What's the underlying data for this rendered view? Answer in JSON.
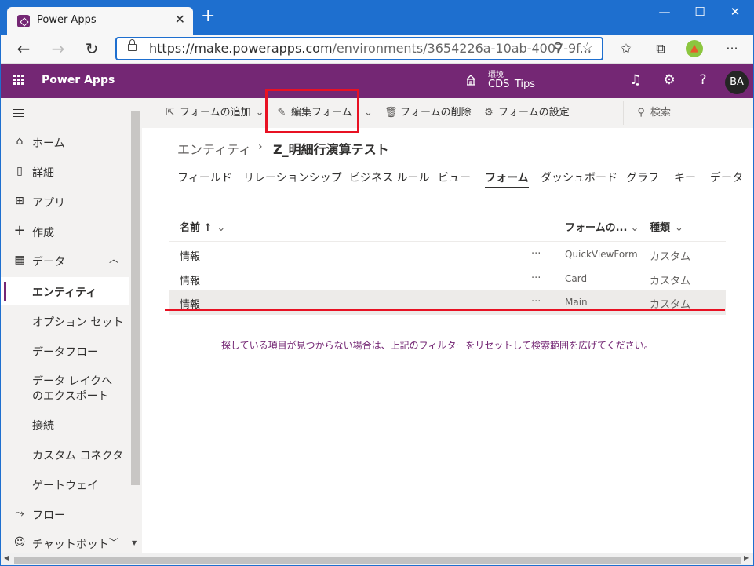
{
  "browser": {
    "tab_title": "Power Apps",
    "tab_close": "✕",
    "new_tab": "+",
    "minimize": "—",
    "maximize": "☐",
    "close": "✕",
    "url_host": "https://make.powerapps.com",
    "url_path": "/environments/3654226a-10ab-4007-9f..."
  },
  "header": {
    "app_name": "Power Apps",
    "env_label": "環境",
    "env_name": "CDS_Tips",
    "avatar_initials": "BA"
  },
  "sidebar": {
    "items": [
      {
        "label": "ホーム",
        "icon": "⌂"
      },
      {
        "label": "詳細",
        "icon": "▯"
      },
      {
        "label": "アプリ",
        "icon": "⊞"
      },
      {
        "label": "作成",
        "icon": "+"
      },
      {
        "label": "データ",
        "icon": "▦"
      },
      {
        "label": "エンティティ"
      },
      {
        "label": "オプション セット"
      },
      {
        "label": "データフロー"
      },
      {
        "label": "データ レイクへのエクスポート"
      },
      {
        "label": "接続"
      },
      {
        "label": "カスタム コネクタ"
      },
      {
        "label": "ゲートウェイ"
      },
      {
        "label": "フロー",
        "icon": "⤳"
      },
      {
        "label": "チャットボット",
        "icon": "☺"
      }
    ]
  },
  "commands": {
    "add_form": "フォームの追加",
    "edit_form": "編集フォーム",
    "delete_form": "フォームの削除",
    "form_settings": "フォームの設定",
    "search": "検索"
  },
  "breadcrumb": {
    "parent": "エンティティ",
    "current": "Z_明細行演算テスト"
  },
  "tabs": [
    "フィールド",
    "リレーションシップ",
    "ビジネス ルール",
    "ビュー",
    "フォーム",
    "ダッシュボード",
    "グラフ",
    "キー",
    "データ"
  ],
  "table": {
    "headers": {
      "name": "名前 ↑",
      "form": "フォームの...",
      "type": "種類"
    },
    "rows": [
      {
        "name": "情報",
        "more": "···",
        "form": "QuickViewForm",
        "type": "カスタム"
      },
      {
        "name": "情報",
        "more": "···",
        "form": "Card",
        "type": "カスタム"
      },
      {
        "name": "情報",
        "more": "···",
        "form": "Main",
        "type": "カスタム"
      }
    ]
  },
  "notice": "探している項目が見つからない場合は、上記のフィルターをリセットして検索範囲を広げてください。",
  "colors": {
    "brand": "#742774",
    "accent": "#1e6fcf",
    "highlight": "#e81123"
  }
}
